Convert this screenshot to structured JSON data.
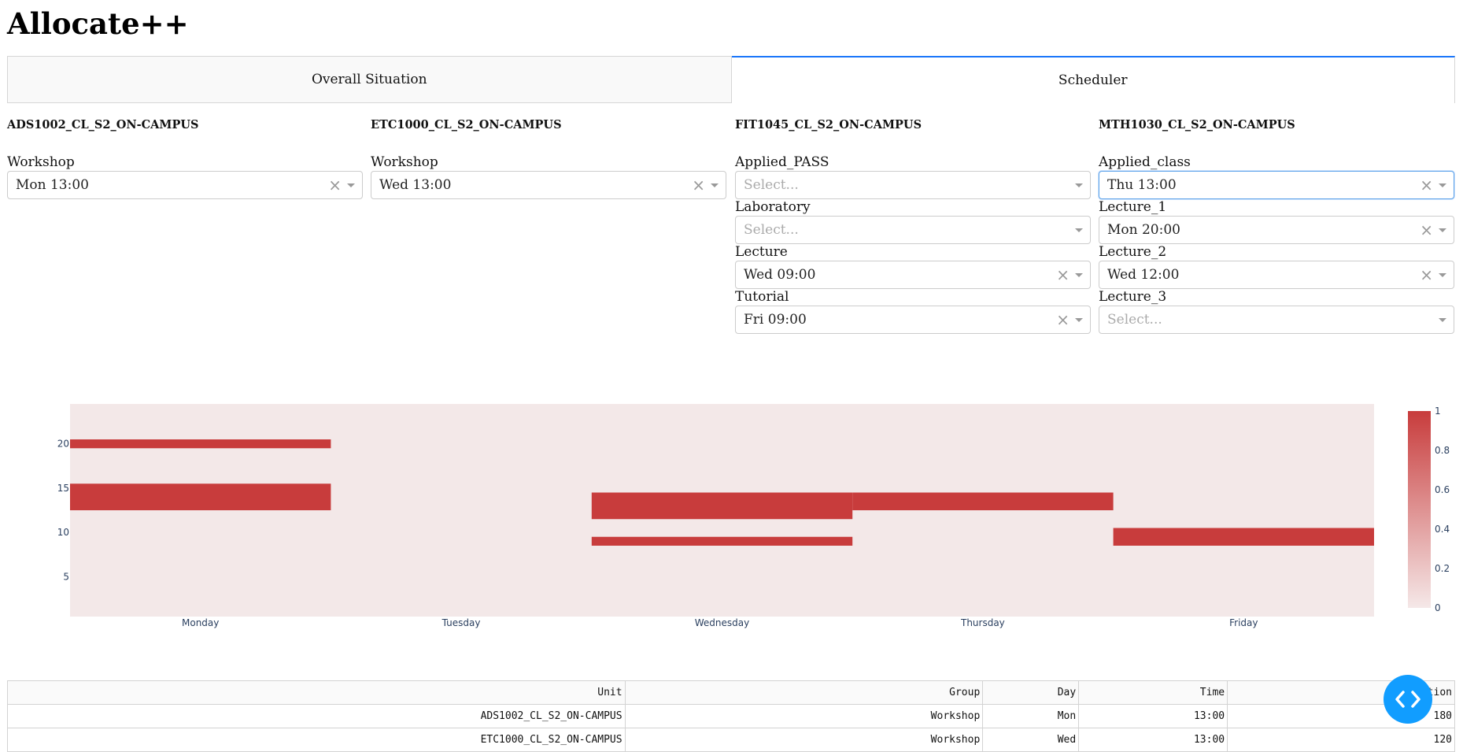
{
  "app": {
    "title": "Allocate++"
  },
  "tabs": [
    {
      "label": "Overall Situation",
      "active": false
    },
    {
      "label": "Scheduler",
      "active": true
    }
  ],
  "units": [
    {
      "name": "ADS1002_CL_S2_ON-CAMPUS",
      "fields": [
        {
          "label": "Workshop",
          "value": "Mon 13:00",
          "placeholder": "",
          "clearable": true,
          "focused": false
        }
      ]
    },
    {
      "name": "ETC1000_CL_S2_ON-CAMPUS",
      "fields": [
        {
          "label": "Workshop",
          "value": "Wed 13:00",
          "placeholder": "",
          "clearable": true,
          "focused": false
        }
      ]
    },
    {
      "name": "FIT1045_CL_S2_ON-CAMPUS",
      "fields": [
        {
          "label": "Applied_PASS",
          "value": "",
          "placeholder": "Select...",
          "clearable": false,
          "focused": false
        },
        {
          "label": "Laboratory",
          "value": "",
          "placeholder": "Select...",
          "clearable": false,
          "focused": false
        },
        {
          "label": "Lecture",
          "value": "Wed 09:00",
          "placeholder": "",
          "clearable": true,
          "focused": false
        },
        {
          "label": "Tutorial",
          "value": "Fri 09:00",
          "placeholder": "",
          "clearable": true,
          "focused": false
        }
      ]
    },
    {
      "name": "MTH1030_CL_S2_ON-CAMPUS",
      "fields": [
        {
          "label": "Applied_class",
          "value": "Thu 13:00",
          "placeholder": "",
          "clearable": true,
          "focused": true
        },
        {
          "label": "Lecture_1",
          "value": "Mon 20:00",
          "placeholder": "",
          "clearable": true,
          "focused": false
        },
        {
          "label": "Lecture_2",
          "value": "Wed 12:00",
          "placeholder": "",
          "clearable": true,
          "focused": false
        },
        {
          "label": "Lecture_3",
          "value": "",
          "placeholder": "Select...",
          "clearable": false,
          "focused": false
        }
      ]
    }
  ],
  "chart_data": {
    "type": "heatmap",
    "x_categories": [
      "Monday",
      "Tuesday",
      "Wednesday",
      "Thursday",
      "Friday"
    ],
    "y_ticks": [
      5,
      10,
      15,
      20
    ],
    "y_range": [
      0.5,
      24.5
    ],
    "colorscale": {
      "min": 0,
      "max": 1,
      "low_color": "#f5e8e8",
      "high_color": "#c83c3c",
      "ticks": [
        "0",
        "0.2",
        "0.4",
        "0.6",
        "0.8",
        "1"
      ]
    },
    "occupied": [
      {
        "day": "Monday",
        "start": 20,
        "end": 21
      },
      {
        "day": "Monday",
        "start": 13,
        "end": 16
      },
      {
        "day": "Wednesday",
        "start": 12,
        "end": 15
      },
      {
        "day": "Wednesday",
        "start": 9,
        "end": 10
      },
      {
        "day": "Thursday",
        "start": 13,
        "end": 15
      },
      {
        "day": "Friday",
        "start": 9,
        "end": 11
      }
    ]
  },
  "table": {
    "columns": [
      "Unit",
      "Group",
      "Day",
      "Time",
      "Duration"
    ],
    "rows": [
      [
        "ADS1002_CL_S2_ON-CAMPUS",
        "Workshop",
        "Mon",
        "13:00",
        "180"
      ],
      [
        "ETC1000_CL_S2_ON-CAMPUS",
        "Workshop",
        "Wed",
        "13:00",
        "120"
      ]
    ]
  },
  "fab": {
    "icon": "code-icon",
    "color": "#119dff"
  }
}
